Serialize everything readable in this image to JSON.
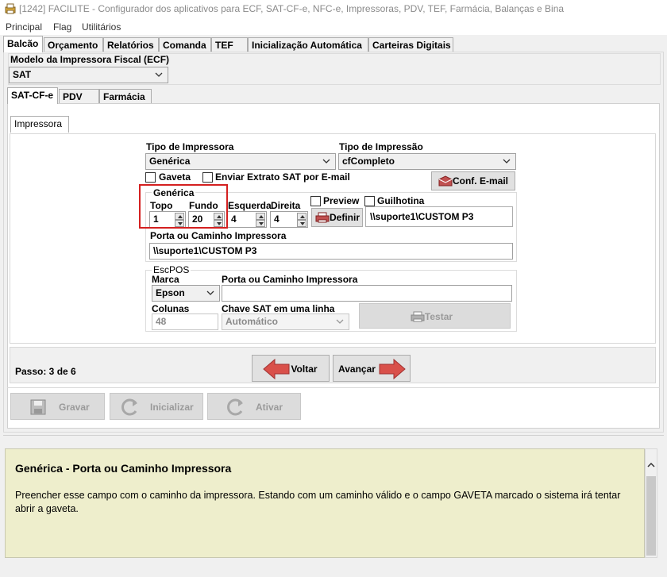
{
  "window": {
    "title": "[1242] FACILITE - Configurador dos aplicativos para ECF, SAT-CF-e, NFC-e, Impressoras, PDV, TEF, Farmácia, Balanças e Bina"
  },
  "menu": [
    "Principal",
    "Flag",
    "Utilitários"
  ],
  "main_tabs": [
    "Balcão",
    "Orçamento",
    "Relatórios",
    "Comanda",
    "TEF",
    "Inicialização Automática",
    "Carteiras Digitais"
  ],
  "modelo": {
    "label": "Modelo da Impressora Fiscal (ECF)",
    "value": "SAT"
  },
  "sub_tabs": [
    "SAT-CF-e",
    "PDV",
    "Farmácia"
  ],
  "inner_tab": "Impressora",
  "tipo_impressora": {
    "label": "Tipo de Impressora",
    "value": "Genérica"
  },
  "tipo_impressao": {
    "label": "Tipo de Impressão",
    "value": "cfCompleto"
  },
  "gaveta_label": "Gaveta",
  "enviar_label": "Enviar Extrato SAT por E-mail",
  "conf_email_label": "Conf. E-mail",
  "generica": {
    "title": "Genérica",
    "topo_label": "Topo",
    "topo_value": "1",
    "fundo_label": "Fundo",
    "fundo_value": "20",
    "esquerda_label": "Esquerda",
    "esquerda_value": "4",
    "direita_label": "Direita",
    "direita_value": "4",
    "preview_label": "Preview",
    "guilhotina_label": "Guilhotina",
    "definir_label": "Definir",
    "printer_path": "\\\\suporte1\\CUSTOM P3",
    "porta_label": "Porta ou Caminho Impressora",
    "porta_value": "\\\\suporte1\\CUSTOM P3"
  },
  "escpos": {
    "title": "EscPOS",
    "marca_label": "Marca",
    "marca_value": "Epson",
    "porta_label": "Porta ou Caminho Impressora",
    "porta_value": "",
    "colunas_label": "Colunas",
    "colunas_value": "48",
    "chave_label": "Chave SAT em uma linha",
    "chave_value": "Automático",
    "testar_label": "Testar"
  },
  "passo": "Passo: 3 de 6",
  "voltar_label": "Voltar",
  "avancar_label": "Avançar",
  "gravar_label": "Gravar",
  "inicializar_label": "Inicializar",
  "ativar_label": "Ativar",
  "help": {
    "title": "Genérica - Porta ou Caminho Impressora",
    "text": "Preencher esse campo com o caminho da impressora. Estando com um caminho válido e o campo GAVETA marcado o sistema irá tentar abrir a gaveta."
  },
  "colors": {
    "highlight": "#d42020",
    "help_bg": "#eeeecc",
    "arrow_red": "#d9504a"
  }
}
